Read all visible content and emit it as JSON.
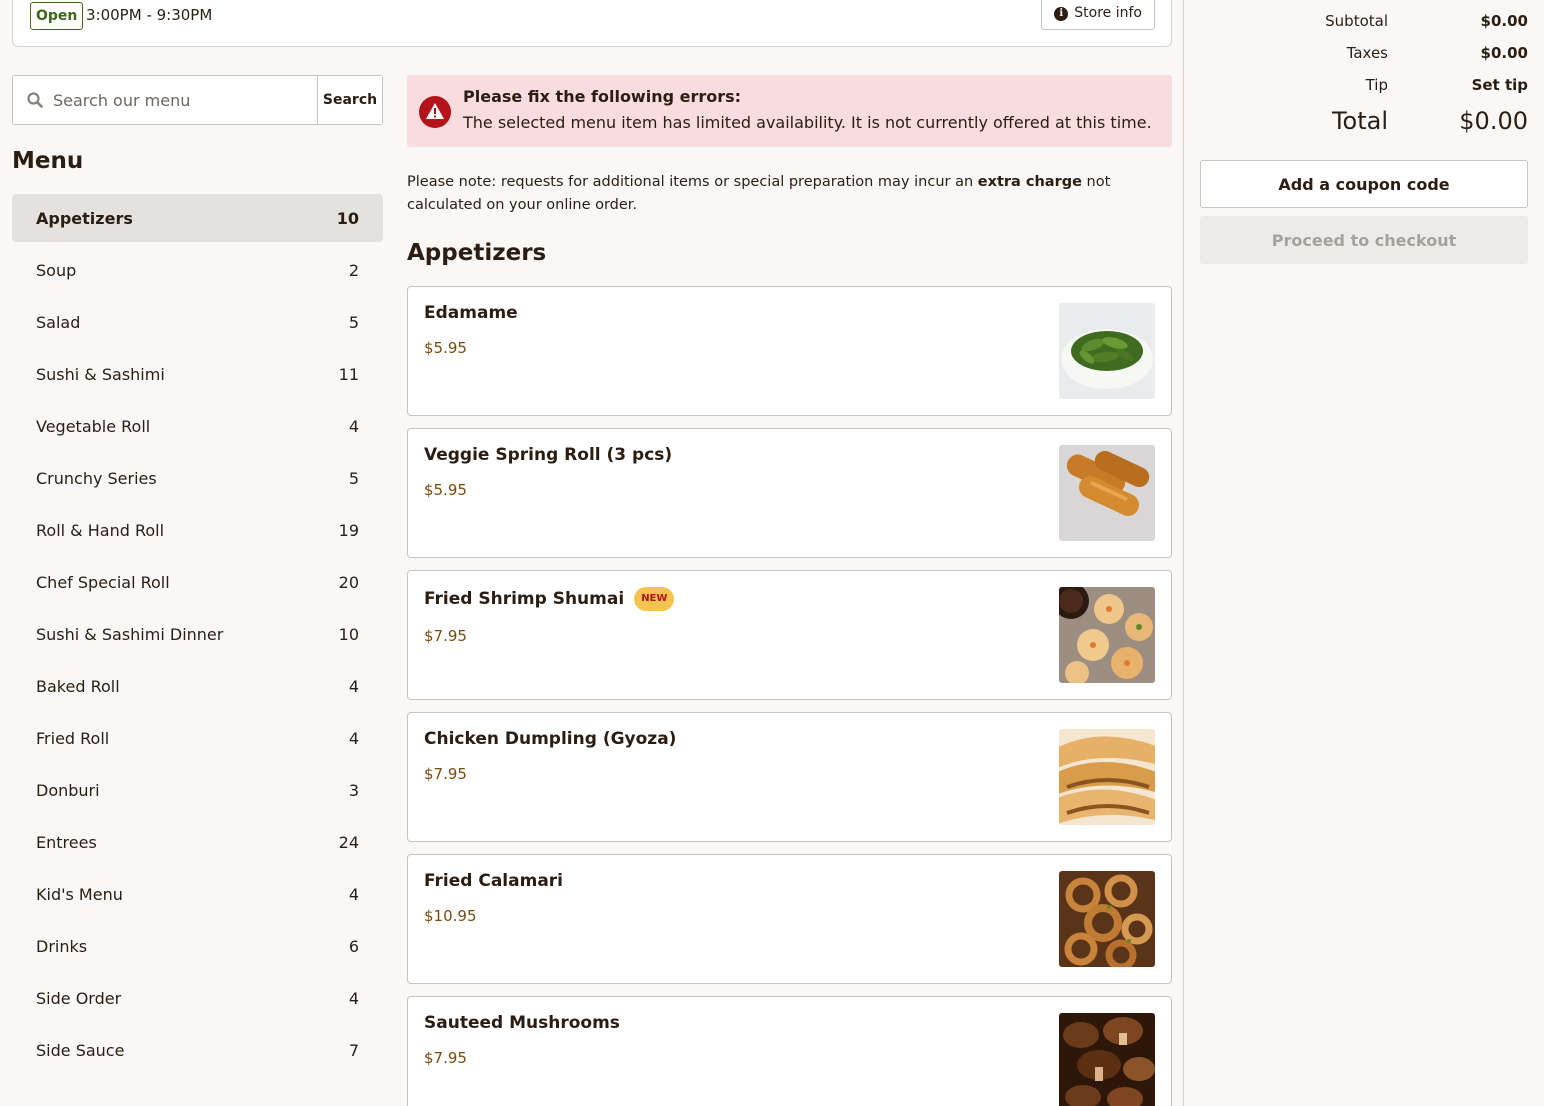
{
  "store": {
    "status": "Open",
    "hours": "3:00PM - 9:30PM",
    "info_button": "Store info"
  },
  "search": {
    "placeholder": "Search our menu",
    "button": "Search"
  },
  "menu": {
    "title": "Menu",
    "categories": [
      {
        "label": "Appetizers",
        "count": "10"
      },
      {
        "label": "Soup",
        "count": "2"
      },
      {
        "label": "Salad",
        "count": "5"
      },
      {
        "label": "Sushi & Sashimi",
        "count": "11"
      },
      {
        "label": "Vegetable Roll",
        "count": "4"
      },
      {
        "label": "Crunchy Series",
        "count": "5"
      },
      {
        "label": "Roll & Hand Roll",
        "count": "19"
      },
      {
        "label": "Chef Special Roll",
        "count": "20"
      },
      {
        "label": "Sushi & Sashimi Dinner",
        "count": "10"
      },
      {
        "label": "Baked Roll",
        "count": "4"
      },
      {
        "label": "Fried Roll",
        "count": "4"
      },
      {
        "label": "Donburi",
        "count": "3"
      },
      {
        "label": "Entrees",
        "count": "24"
      },
      {
        "label": "Kid's Menu",
        "count": "4"
      },
      {
        "label": "Drinks",
        "count": "6"
      },
      {
        "label": "Side Order",
        "count": "4"
      },
      {
        "label": "Side Sauce",
        "count": "7"
      }
    ]
  },
  "error": {
    "title": "Please fix the following errors:",
    "message": "The selected menu item has limited availability. It is not currently offered at this time."
  },
  "note": {
    "before": "Please note: requests for additional items or special preparation may incur an ",
    "bold": "extra charge",
    "after": " not calculated on your online order."
  },
  "section": {
    "title": "Appetizers",
    "items": [
      {
        "name": "Edamame",
        "price": "$5.95",
        "badge": ""
      },
      {
        "name": "Veggie Spring Roll (3 pcs)",
        "price": "$5.95",
        "badge": ""
      },
      {
        "name": "Fried Shrimp Shumai",
        "price": "$7.95",
        "badge": "NEW"
      },
      {
        "name": "Chicken Dumpling (Gyoza)",
        "price": "$7.95",
        "badge": ""
      },
      {
        "name": "Fried Calamari",
        "price": "$10.95",
        "badge": ""
      },
      {
        "name": "Sauteed Mushrooms",
        "price": "$7.95",
        "badge": ""
      }
    ]
  },
  "cart": {
    "subtotal_label": "Subtotal",
    "subtotal_value": "$0.00",
    "taxes_label": "Taxes",
    "taxes_value": "$0.00",
    "tip_label": "Tip",
    "tip_link": "Set tip",
    "total_label": "Total",
    "total_value": "$0.00",
    "coupon_button": "Add a coupon code",
    "checkout_button": "Proceed to checkout"
  },
  "colors": {
    "accent_link": "#1b7f94",
    "price": "#7a4a0e",
    "error_bg": "#f9dcde",
    "error_icon": "#b5131b",
    "open_green": "#3d6a1a"
  }
}
